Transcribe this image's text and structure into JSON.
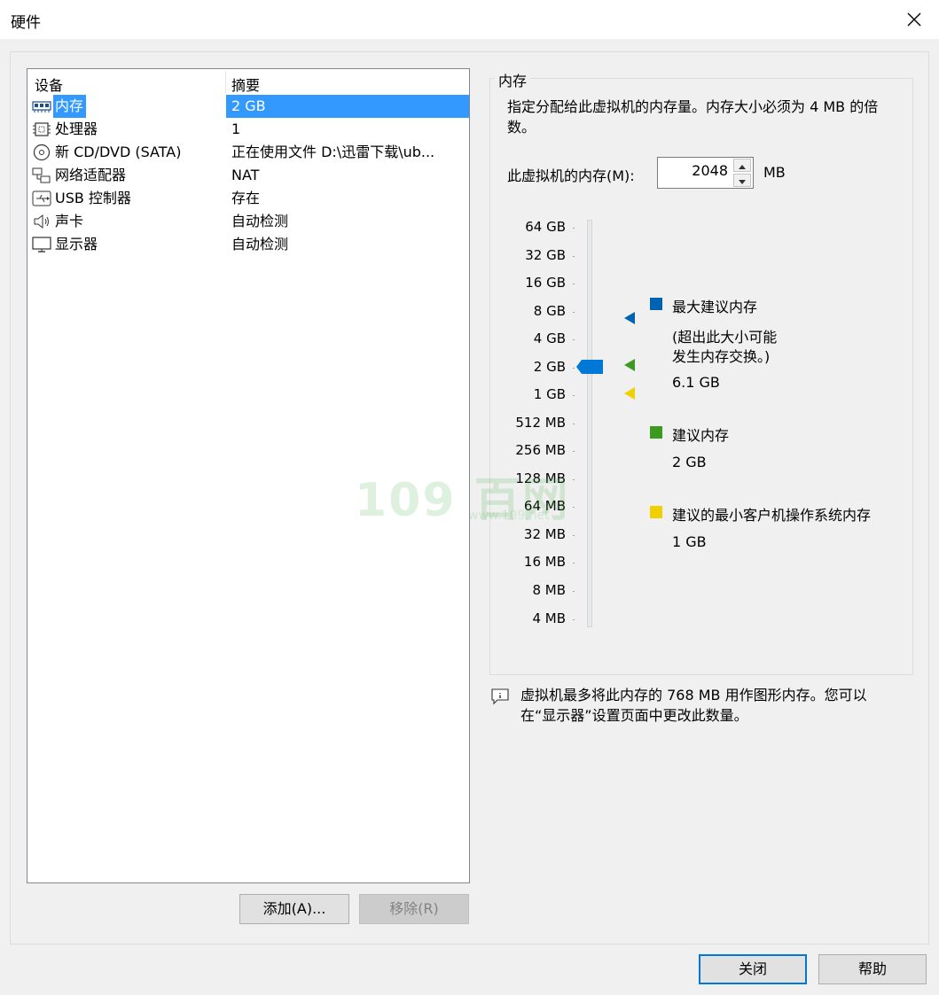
{
  "window": {
    "title": "硬件",
    "close_icon": "close-icon"
  },
  "device_list": {
    "headers": {
      "device": "设备",
      "summary": "摘要"
    },
    "rows": [
      {
        "icon": "memory-icon",
        "name": "内存",
        "summary": "2 GB",
        "selected": true
      },
      {
        "icon": "processor-icon",
        "name": "处理器",
        "summary": "1"
      },
      {
        "icon": "cd-dvd-icon",
        "name": "新 CD/DVD (SATA)",
        "summary": "正在使用文件 D:\\迅雷下载\\ub..."
      },
      {
        "icon": "network-adapter-icon",
        "name": "网络适配器",
        "summary": "NAT"
      },
      {
        "icon": "usb-icon",
        "name": "USB 控制器",
        "summary": "存在"
      },
      {
        "icon": "sound-card-icon",
        "name": "声卡",
        "summary": "自动检测"
      },
      {
        "icon": "display-icon",
        "name": "显示器",
        "summary": "自动检测"
      }
    ]
  },
  "buttons": {
    "add": "添加(A)...",
    "remove": "移除(R)",
    "close": "关闭",
    "help": "帮助"
  },
  "memory": {
    "group_title": "内存",
    "description": "指定分配给此虚拟机的内存量。内存大小必须为 4 MB 的倍数。",
    "field_label": "此虚拟机的内存(M):",
    "value": "2048",
    "unit": "MB",
    "scale_labels": [
      "64 GB",
      "32 GB",
      "16 GB",
      "8 GB",
      "4 GB",
      "2 GB",
      "1 GB",
      "512 MB",
      "256 MB",
      "128 MB",
      "64 MB",
      "32 MB",
      "16 MB",
      "8 MB",
      "4 MB"
    ],
    "slider_value": "2 GB",
    "legend": {
      "max": {
        "title": "最大建议内存",
        "note_line1": "(超出此大小可能",
        "note_line2": "发生内存交换。)",
        "value": "6.1 GB",
        "color": "#0063b1"
      },
      "recommended": {
        "title": "建议内存",
        "value": "2 GB",
        "color": "#3c9a1f"
      },
      "min_guest": {
        "title": "建议的最小客户机操作系统内存",
        "value": "1 GB",
        "color": "#f0d000"
      }
    },
    "info_line1": "虚拟机最多将此内存的 768 MB 用作图形内存。您可以",
    "info_line2": "在“显示器”设置页面中更改此数量。"
  },
  "watermark": {
    "text": "109 百网",
    "sub": "www.109.net"
  },
  "colors": {
    "selection": "#3399ff",
    "accent": "#0078d7",
    "thumb": "#0078d7"
  }
}
